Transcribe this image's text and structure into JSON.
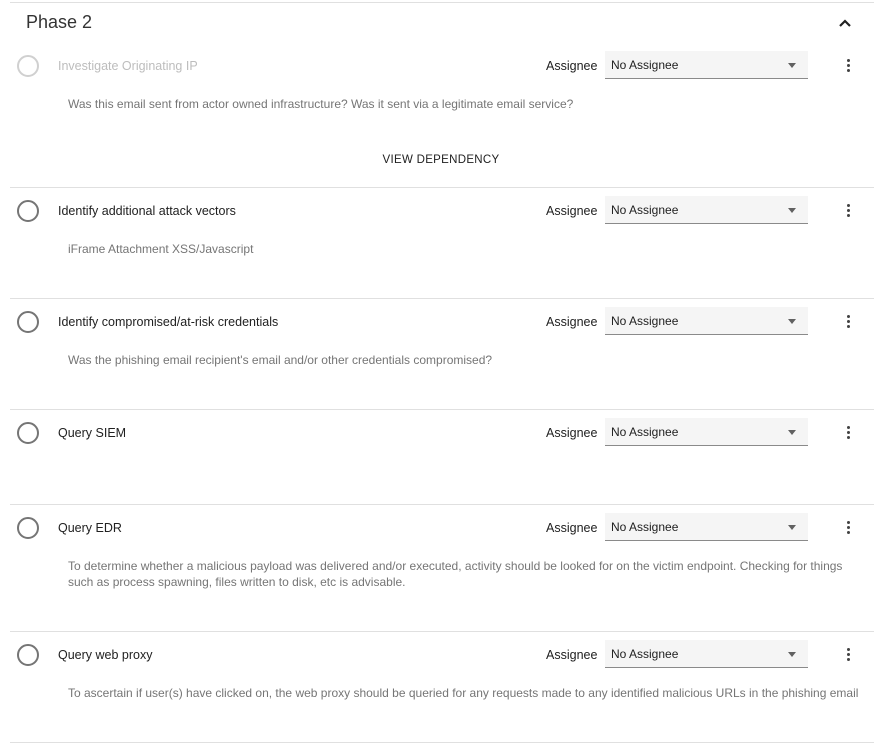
{
  "phase": {
    "title": "Phase 2"
  },
  "common": {
    "assignee_label": "Assignee",
    "assignee_value": "No Assignee"
  },
  "tasks": [
    {
      "name": "Investigate Originating IP",
      "description": "Was this email sent from actor owned infrastructure? Was it sent via a legitimate email service?",
      "disabled": true,
      "action": "VIEW DEPENDENCY"
    },
    {
      "name": "Identify additional attack vectors",
      "description": "iFrame Attachment XSS/Javascript"
    },
    {
      "name": "Identify compromised/at-risk credentials",
      "description": "Was the phishing email recipient's email and/or other credentials compromised?"
    },
    {
      "name": "Query SIEM",
      "description": ""
    },
    {
      "name": "Query EDR",
      "description": "To determine whether a malicious payload was delivered and/or executed, activity should be looked for on the victim endpoint. Checking for things such as process spawning, files written to disk, etc is advisable."
    },
    {
      "name": "Query web proxy",
      "description": "To ascertain if user(s) have clicked on, the web proxy should be queried for any requests made to any identified malicious URLs in the phishing email"
    }
  ],
  "icons": {
    "collapse": "chevron-up-icon",
    "more": "more-vert-icon",
    "dropdown": "arrow-drop-down-icon"
  }
}
